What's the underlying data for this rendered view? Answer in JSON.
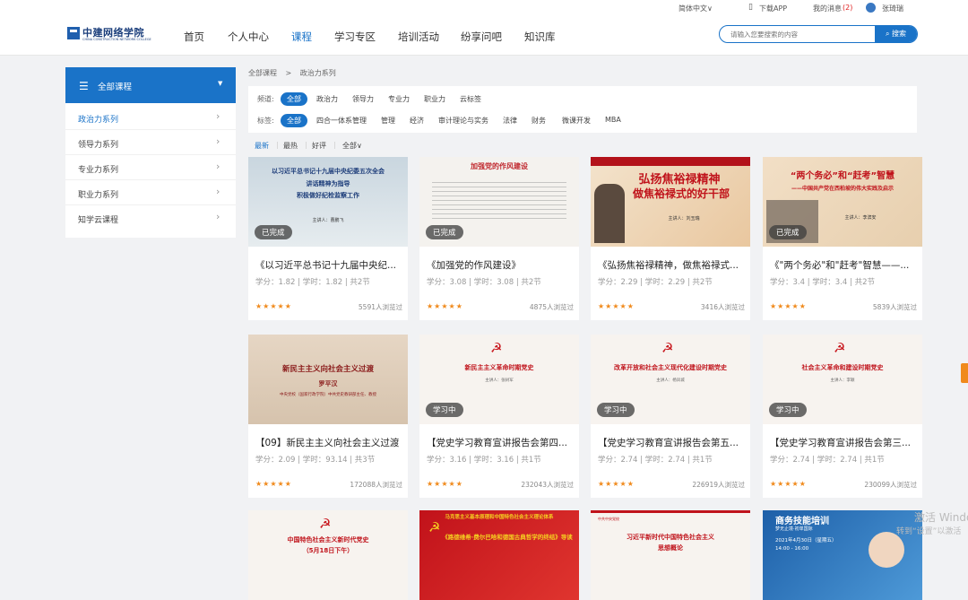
{
  "topbar": {
    "lang": "简体中文∨",
    "app": "下载APP",
    "msg": "我的消息",
    "msg_count": "(2)",
    "user": "张琦瑞"
  },
  "logo": {
    "cn": "中建网络学院",
    "en": "CHINA CONSTRUCTION NETWORK COLLEGE"
  },
  "nav": [
    "首页",
    "个人中心",
    "课程",
    "学习专区",
    "培训活动",
    "纷享问吧",
    "知识库"
  ],
  "search": {
    "placeholder": "请输入您要搜索的内容",
    "button": "搜索"
  },
  "sidebar": {
    "header": "全部课程",
    "items": [
      "政治力系列",
      "领导力系列",
      "专业力系列",
      "职业力系列",
      "知学云课程"
    ]
  },
  "breadcrumb": {
    "root": "全部课程",
    "sep": ">",
    "current": "政治力系列"
  },
  "filters": {
    "channel_label": "频道:",
    "channels": [
      "全部",
      "政治力",
      "领导力",
      "专业力",
      "职业力",
      "云标签"
    ],
    "tag_label": "标签:",
    "tags": [
      "全部",
      "四合一体系管理",
      "管理",
      "经济",
      "审计理论与实务",
      "法律",
      "财务",
      "微课开发",
      "MBA"
    ]
  },
  "sort": [
    "最新",
    "最热",
    "好评",
    "全部∨"
  ],
  "courses": [
    {
      "title": "《以习近平总书记十九届中央纪...",
      "meta": "学分：1.82  |  学时：1.82  |  共2节",
      "views": "5591人浏览过",
      "status": "已完成",
      "thumb1": "以习近平总书记十九届中央纪委五次全会",
      "thumb2": "讲话精神为指导",
      "thumb3": "积极做好纪检监察工作",
      "thumb4": "主讲人：曹鹏飞"
    },
    {
      "title": "《加强党的作风建设》",
      "meta": "学分：3.08  |  学时：3.08  |  共2节",
      "views": "4875人浏览过",
      "status": "已完成",
      "thumb1": "加强党的作风建设",
      "thumb2": "",
      "thumb3": "",
      "thumb4": ""
    },
    {
      "title": "《弘扬焦裕禄精神，做焦裕禄式...",
      "meta": "学分：2.29  |  学时：2.29  |  共2节",
      "views": "3416人浏览过",
      "status": "",
      "thumb1": "弘扬焦裕禄精神",
      "thumb2": "做焦裕禄式的好干部",
      "thumb3": "主讲人：刘玉瑞",
      "thumb4": ""
    },
    {
      "title": "《\"两个务必\"和\"赶考\"智慧——...",
      "meta": "学分：3.4  |  学时：3.4  |  共2节",
      "views": "5839人浏览过",
      "status": "已完成",
      "thumb1": "“两个务必”和“赶考”智慧",
      "thumb2": "——中国共产党在西柏坡的伟大实践及启示",
      "thumb3": "主讲人：李滨安",
      "thumb4": ""
    },
    {
      "title": "【09】新民主主义向社会主义过渡",
      "meta": "学分：2.09  |  学时：93.14  |  共3节",
      "views": "172088人浏览过",
      "status": "",
      "thumb1": "新民主主义向社会主义过渡",
      "thumb2": "罗平汉",
      "thumb3": "中央党校（国家行政学院）中共党史教研部主任、教授",
      "thumb4": ""
    },
    {
      "title": "【党史学习教育宣讲报告会第四...",
      "meta": "学分：3.16  |  学时：3.16  |  共1节",
      "views": "232043人浏览过",
      "status": "学习中",
      "thumb1": "新民主主义革命时期党史",
      "thumb2": "主讲人：张树军",
      "thumb3": "",
      "thumb4": ""
    },
    {
      "title": "【党史学习教育宣讲报告会第五...",
      "meta": "学分：2.74  |  学时：2.74  |  共1节",
      "views": "226919人浏览过",
      "status": "学习中",
      "thumb1": "改革开放和社会主义现代化建设时期党史",
      "thumb2": "主讲人：杨凤城",
      "thumb3": "",
      "thumb4": ""
    },
    {
      "title": "【党史学习教育宣讲报告会第三...",
      "meta": "学分：2.74  |  学时：2.74  |  共1节",
      "views": "230099人浏览过",
      "status": "学习中",
      "thumb1": "社会主义革命和建设时期党史",
      "thumb2": "主讲人：李颖",
      "thumb3": "",
      "thumb4": ""
    },
    {
      "title": "",
      "meta": "",
      "views": "",
      "status": "",
      "thumb1": "中国特色社会主义新时代党史",
      "thumb2": "（5月18日下午）",
      "thumb3": "",
      "thumb4": ""
    },
    {
      "title": "",
      "meta": "",
      "views": "",
      "status": "",
      "thumb1": "马克思主义基本原理和中国特色社会主义理论体系",
      "thumb2": "《路德维希·费尔巴哈和德国古典哲学的终结》导读",
      "thumb3": "",
      "thumb4": ""
    },
    {
      "title": "",
      "meta": "",
      "views": "",
      "status": "",
      "thumb1": "习近平新时代中国特色社会主义",
      "thumb2": "思想概论",
      "thumb3": "中共中央党校",
      "thumb4": ""
    },
    {
      "title": "",
      "meta": "",
      "views": "",
      "status": "",
      "thumb1": "商务技能培训",
      "thumb2": "梦无止境·初单国际",
      "thumb3": "2021年4月30日（星期五）",
      "thumb4": "14:00 - 16:00"
    }
  ],
  "stars": "★★★★★",
  "overlay": {
    "line1": "激活 Windo",
    "line2": "转到“设置”以激活"
  },
  "colors": {
    "accent": "#1a73c8",
    "star": "#f08a1c",
    "party_red": "#c8161d"
  },
  "icons": {
    "menu": "list-icon",
    "chevron": "chevron-right-icon",
    "phone": "phone-icon",
    "avatar": "avatar-icon",
    "search": "search-icon"
  }
}
